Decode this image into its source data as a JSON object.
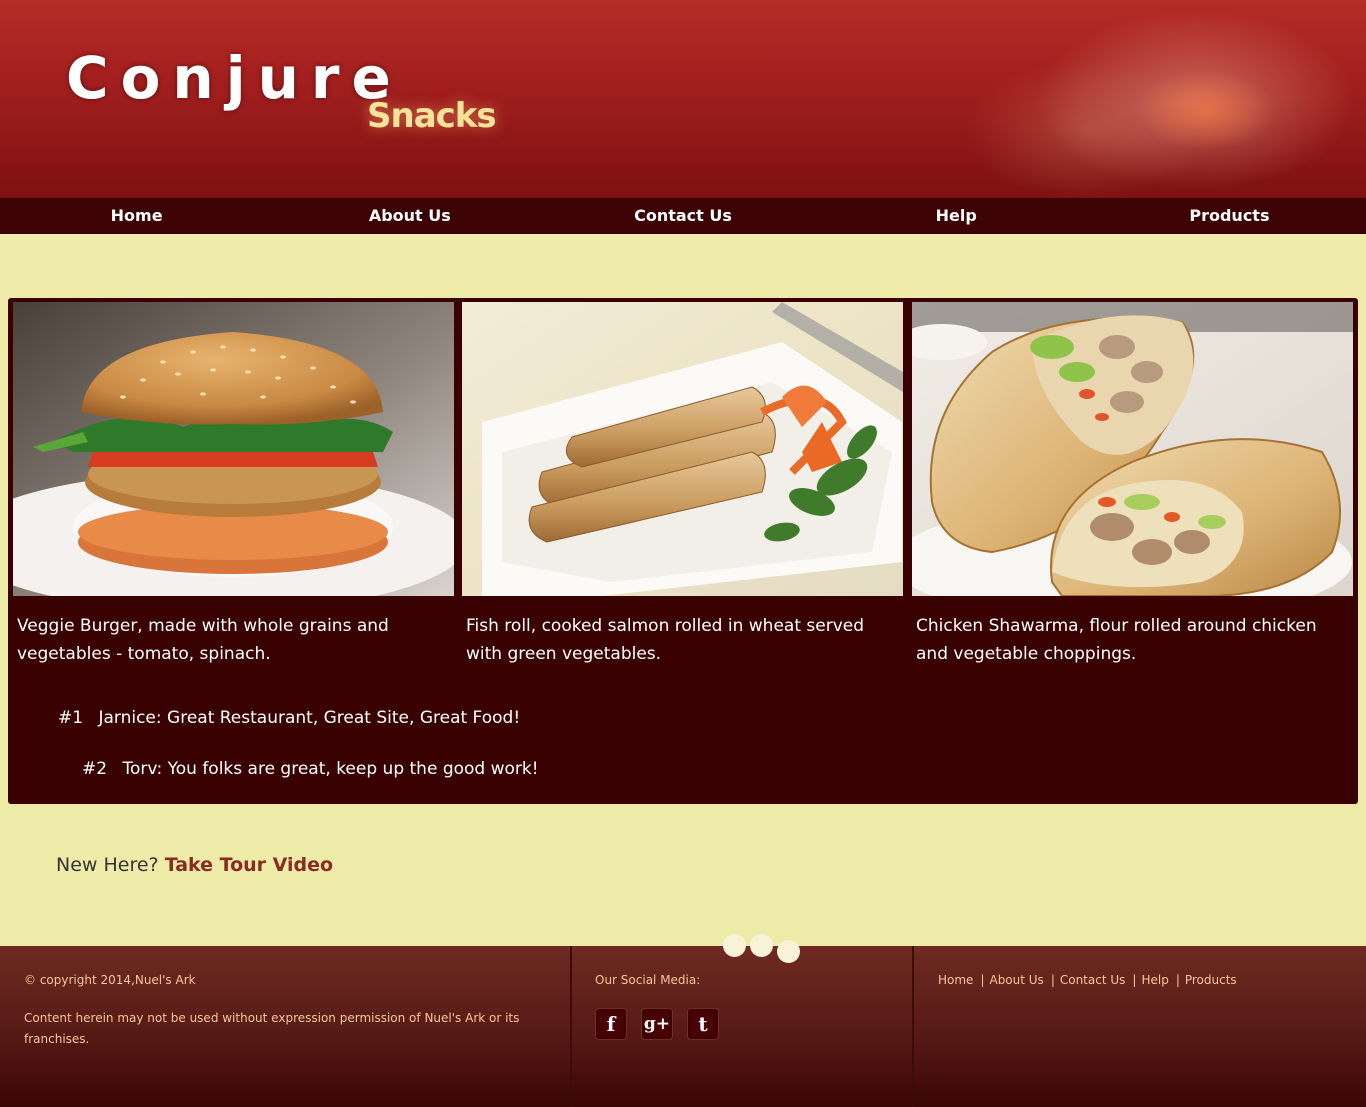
{
  "brand": {
    "name": "Conjure",
    "tagline": "Snacks"
  },
  "nav": [
    {
      "label": "Home"
    },
    {
      "label": "About Us"
    },
    {
      "label": "Contact Us"
    },
    {
      "label": "Help"
    },
    {
      "label": "Products"
    }
  ],
  "products": [
    {
      "image": "veggie-burger-photo",
      "caption": "Veggie Burger, made with whole grains and vegetables - tomato, spinach."
    },
    {
      "image": "fish-roll-photo",
      "caption": "Fish roll, cooked salmon rolled in wheat served with green vegetables."
    },
    {
      "image": "chicken-shawarma-photo",
      "caption": "Chicken Shawarma, flour rolled around chicken and vegetable choppings."
    }
  ],
  "reviews": [
    {
      "num": "#1",
      "text": "Jarnice: Great Restaurant, Great Site, Great Food!"
    },
    {
      "num": "#2",
      "text": "Torv: You folks are great, keep up the good work!"
    }
  ],
  "tour": {
    "prefix": "New Here?",
    "link": "Take Tour Video"
  },
  "footer": {
    "copyright": "© copyright 2014,Nuel's Ark",
    "disclaimer": "Content herein may not be used without expression permission of Nuel's Ark or its franchises.",
    "social_title": "Our Social Media:",
    "social": [
      {
        "icon": "facebook-icon",
        "glyph": "f"
      },
      {
        "icon": "google-plus-icon",
        "glyph": "g+"
      },
      {
        "icon": "tumblr-icon",
        "glyph": "t"
      }
    ],
    "links": [
      "Home",
      "About Us",
      "Contact Us",
      "Help",
      "Products"
    ],
    "separator": "|"
  },
  "colors": {
    "page_bg": "#eeeba8",
    "header": "#a11e1e",
    "nav": "#3d0203",
    "panel": "#3a0102",
    "tagline": "#f7e29a",
    "footer_text": "#f6c897",
    "tour_link": "#8a2b22"
  }
}
